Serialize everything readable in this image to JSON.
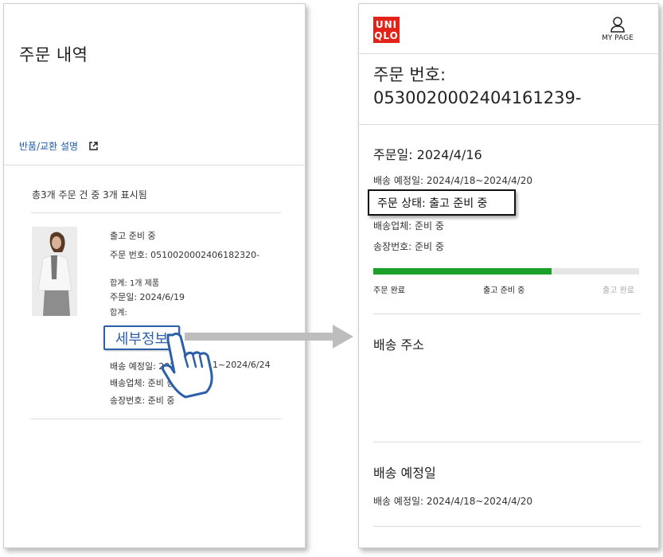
{
  "left": {
    "title": "주문 내역",
    "return_link": "반품/교환 설명",
    "count_text": "총3개 주문 건 중 3개 표시됨",
    "order": {
      "status": "출고 준비 중",
      "order_number": "주문 번호: 0510020002406182320-",
      "total_items": "합계: 1개 제품",
      "order_date": "주문일: 2024/6/19",
      "total": "합계:",
      "details_button": "세부정보",
      "delivery_est_start": "배송 예정일: 202",
      "delivery_est_end": "1~2024/6/24",
      "carrier": "배송업체: 준비 중",
      "tracking": "송장번호: 준비 중"
    }
  },
  "right": {
    "logo_top": "UNI",
    "logo_bottom": "QLO",
    "mypage_label": "MY PAGE",
    "order_number_label": "주문 번호:",
    "order_number_value": "0530020002404161239-",
    "order_date": "주문일: 2024/4/16",
    "delivery_est": "배송 예정일: 2024/4/18~2024/4/20",
    "status": "주문 상태: 출고 준비 중",
    "carrier": "배송업체: 준비 중",
    "tracking": "송장번호: 준비 중",
    "progress_fraction": 0.67,
    "steps": [
      "주문 완료",
      "출고 준비 중",
      "출고 완료"
    ],
    "address_heading": "배송 주소",
    "delivery_date_heading": "배송 예정일",
    "delivery_date_value": "배송 예정일: 2024/4/18~2024/4/20"
  },
  "colors": {
    "link_blue": "#1e5ba8",
    "button_blue": "#2b5fa7",
    "progress_green": "#1ba12a",
    "brand_red": "#e2231a"
  },
  "icons": {
    "external_link": "external-link-icon",
    "mypage": "user-icon",
    "pointer": "hand-pointer-icon",
    "arrow": "right-arrow-icon"
  }
}
